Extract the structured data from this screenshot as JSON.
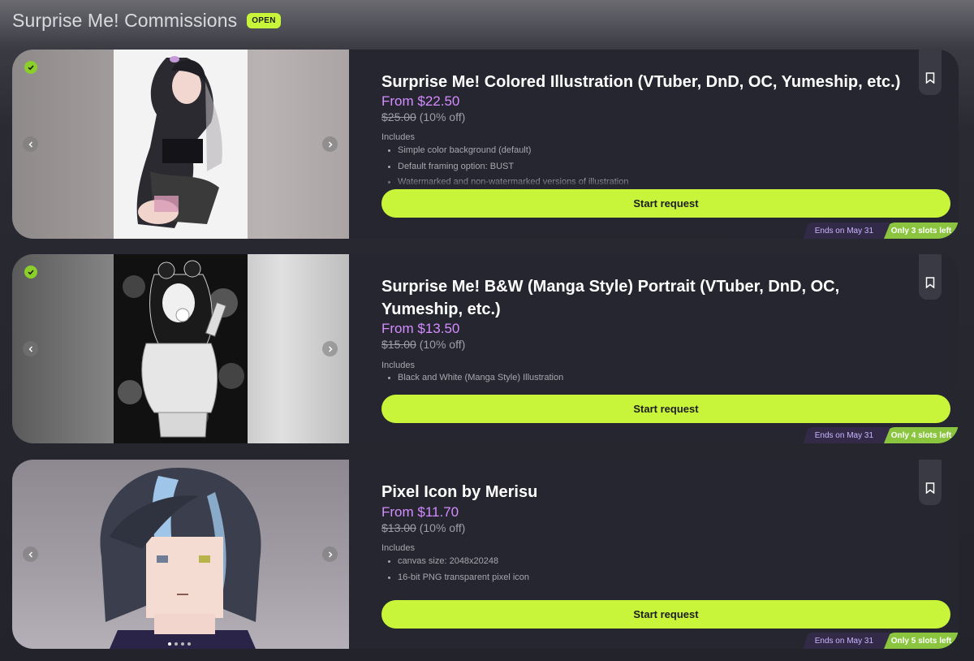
{
  "header": {
    "title": "Surprise Me! Commissions",
    "status_badge": "OPEN"
  },
  "cards": [
    {
      "title": "Surprise Me! Colored Illustration (VTuber, DnD, OC, Yumeship, etc.)",
      "price": "From $22.50",
      "old_price": "$25.00",
      "discount": "(10% off)",
      "includes_label": "Includes",
      "includes": [
        "Simple color background (default)",
        "Default framing option: BUST",
        "Watermarked and non-watermarked versions of illustration"
      ],
      "button_label": "Start request",
      "ends": "Ends on May 31",
      "slots": "Only 3 slots left"
    },
    {
      "title": "Surprise Me! B&W (Manga Style) Portrait (VTuber, DnD, OC, Yumeship, etc.)",
      "price": "From $13.50",
      "old_price": "$15.00",
      "discount": "(10% off)",
      "includes_label": "Includes",
      "includes": [
        "Black and White (Manga Style) Illustration"
      ],
      "button_label": "Start request",
      "ends": "Ends on May 31",
      "slots": "Only 4 slots left"
    },
    {
      "title": "Pixel Icon by Merisu",
      "price": "From $11.70",
      "old_price": "$13.00",
      "discount": "(10% off)",
      "includes_label": "Includes",
      "includes": [
        "canvas size: 2048x20248",
        "16-bit PNG transparent pixel icon"
      ],
      "button_label": "Start request",
      "ends": "Ends on May 31",
      "slots": "Only 5 slots left"
    }
  ],
  "colors": {
    "accent_green": "#c8f53a",
    "price_purple": "#d48cff",
    "slots_green": "#8bc53f",
    "card_bg": "#262630"
  },
  "icons": [
    "verified-check-icon",
    "chevron-left-icon",
    "chevron-right-icon",
    "bookmark-icon"
  ]
}
